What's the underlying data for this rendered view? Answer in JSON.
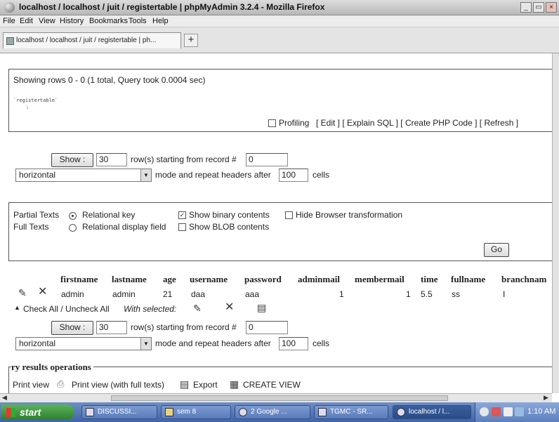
{
  "window": {
    "title": "localhost / localhost / juit / registertable | phpMyAdmin 3.2.4 - Mozilla Firefox",
    "min": "_",
    "restore": "▭",
    "close": "×"
  },
  "menu": [
    "File",
    "Edit",
    "View",
    "History",
    "Bookmarks",
    "Tools",
    "Help"
  ],
  "tab": {
    "label": "localhost / localhost / juit / registertable | ph...",
    "new_tab": "+"
  },
  "query": {
    "status": "Showing rows 0 - 0 (1 total, Query took 0.0004 sec)",
    "sql_line1": "`registertable`",
    "sql_line2": ";",
    "profiling": "Profiling",
    "links": "[ Edit ] [ Explain SQL ] [ Create PHP Code ] [ Refresh ]"
  },
  "nav_top": {
    "show_button": "Show :",
    "rows_value": "30",
    "rows_label": "row(s) starting from record #",
    "start_value": "0",
    "mode_value": "horizontal",
    "mode_label": "mode and repeat headers after",
    "repeat_value": "100",
    "cells_label": "cells"
  },
  "options": {
    "partial_texts": "Partial Texts",
    "full_texts": "Full Texts",
    "relational_key": "Relational key",
    "relational_display": "Relational display field",
    "show_binary": "Show binary contents",
    "show_blob": "Show BLOB contents",
    "hide_transform": "Hide Browser transformation",
    "go": "Go"
  },
  "table": {
    "headers": [
      "firstname",
      "lastname",
      "age",
      "username",
      "password",
      "adminmail",
      "membermail",
      "time",
      "fullname",
      "branchnam"
    ],
    "row": [
      "admin",
      "admin",
      "21",
      "daa",
      "aaa",
      "1",
      "1",
      "5.5",
      "ss",
      "I"
    ]
  },
  "bulk": {
    "check_all": "Check All / Uncheck All",
    "with_selected": "With selected:"
  },
  "nav_bottom": {
    "show_button": "Show :",
    "rows_value": "30",
    "rows_label": "row(s) starting from record #",
    "start_value": "0",
    "mode_value": "horizontal",
    "mode_label": "mode and repeat headers after",
    "repeat_value": "100",
    "cells_label": "cells"
  },
  "results_ops": {
    "legend": "ry results operations",
    "print_view": "Print view",
    "print_full": "Print view (with full texts)",
    "export": "Export",
    "create_view": "CREATE VIEW"
  },
  "taskbar": {
    "start": "start",
    "tasks": [
      "DISCUSSI...",
      "sem 8",
      "2 Google ...",
      "TGMC - SR...",
      "localhost / l..."
    ],
    "clock": "1:10 AM"
  }
}
